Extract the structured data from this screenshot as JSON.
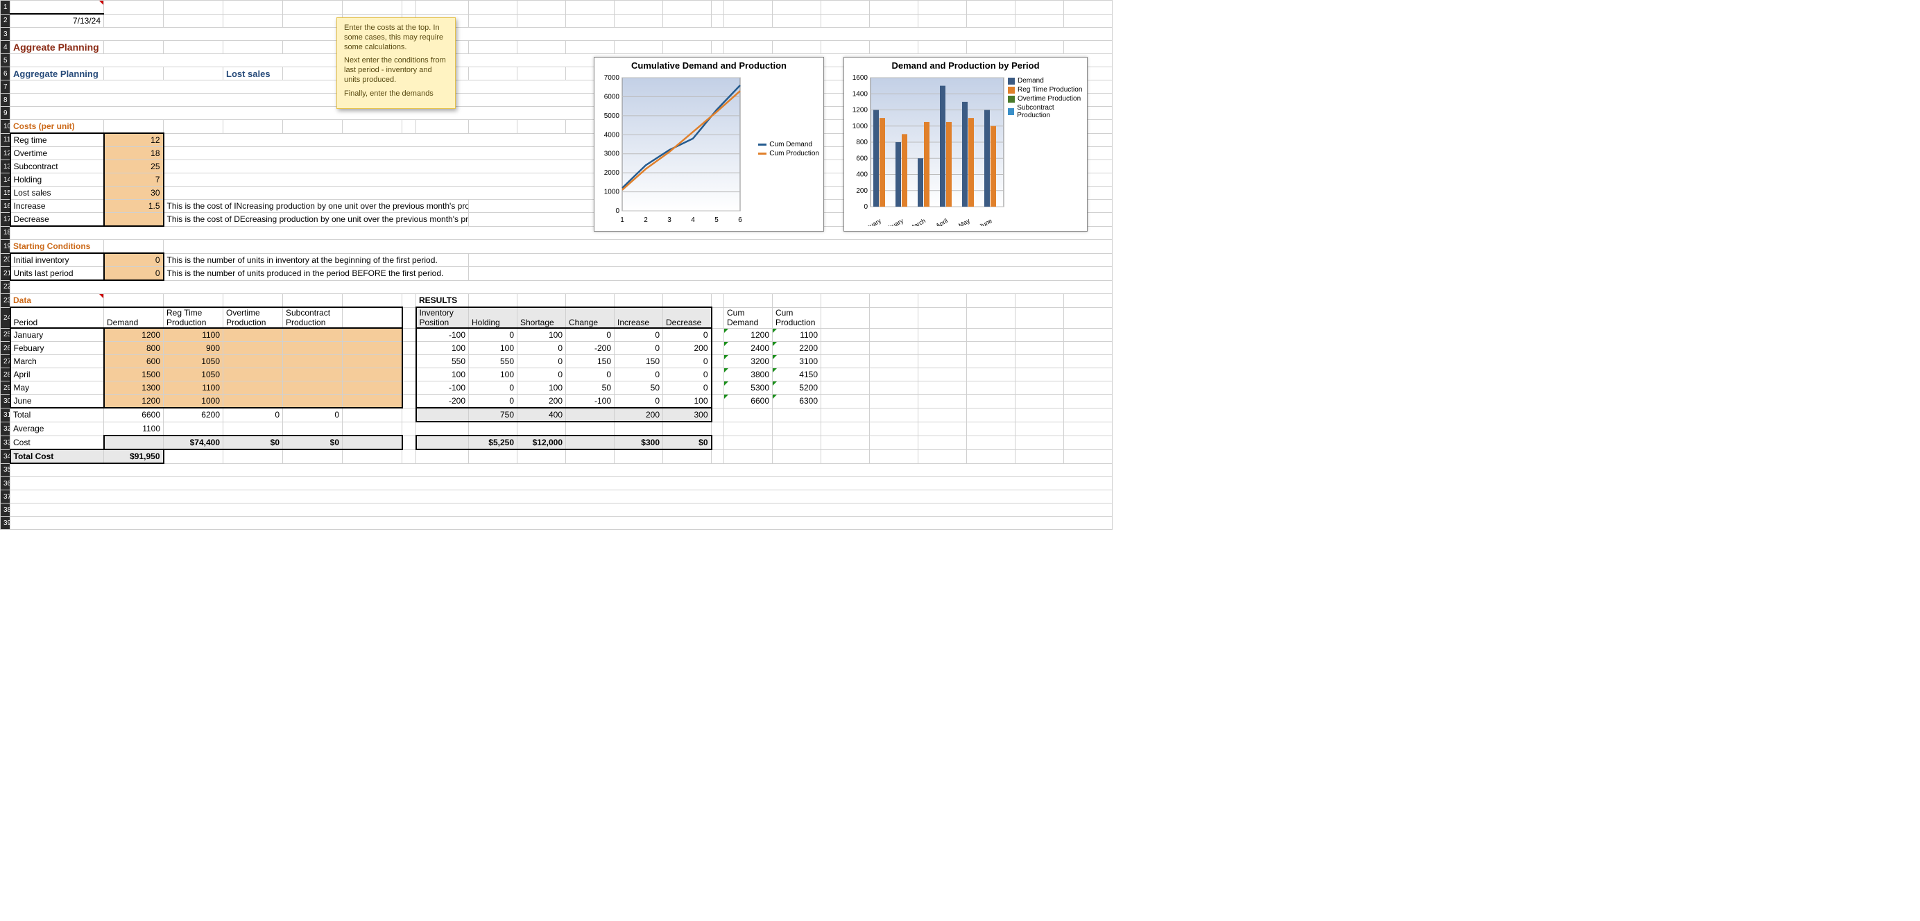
{
  "date": "7/13/24",
  "titles": {
    "aggreate": "Aggreate Planning",
    "aggregate": "Aggregate Planning",
    "lost_sales": "Lost sales"
  },
  "note": {
    "p1": "Enter the costs at the top. In some cases, this may require some calculations.",
    "p2": "Next enter the conditions from last period - inventory and units produced.",
    "p3": "Finally, enter the demands"
  },
  "sections": {
    "costs": "Costs (per unit)",
    "starting": "Starting Conditions",
    "data": "Data",
    "results": "RESULTS"
  },
  "costs": {
    "rows": [
      {
        "label": "Reg time",
        "value": "12"
      },
      {
        "label": "Overtime",
        "value": "18"
      },
      {
        "label": "Subcontract",
        "value": "25"
      },
      {
        "label": "Holding",
        "value": "7"
      },
      {
        "label": "Lost sales",
        "value": "30"
      },
      {
        "label": "Increase",
        "value": "1.5",
        "note": "This is the cost of INcreasing production by one unit over the previous month's production quantity."
      },
      {
        "label": "Decrease",
        "value": "",
        "note": "This is the cost of DEcreasing production by one unit over the previous month's production quantity."
      }
    ],
    "unit_word": "unit"
  },
  "starting": {
    "rows": [
      {
        "label": "Initial inventory",
        "value": "0",
        "note": "This is the number of units in inventory at the beginning of the first period."
      },
      {
        "label": "Units last period",
        "value": "0",
        "note": "This is the number of units produced in the period BEFORE the first period."
      }
    ]
  },
  "data": {
    "headers": {
      "period": "Period",
      "demand": "Demand",
      "reg": "Reg Time Production",
      "ot": "Overtime Production",
      "sub": "Subcontract Production"
    },
    "rows": [
      {
        "period": "January",
        "demand": "1200",
        "reg": "1100",
        "ot": "",
        "sub": ""
      },
      {
        "period": "Febuary",
        "demand": "800",
        "reg": "900",
        "ot": "",
        "sub": ""
      },
      {
        "period": "March",
        "demand": "600",
        "reg": "1050",
        "ot": "",
        "sub": ""
      },
      {
        "period": "April",
        "demand": "1500",
        "reg": "1050",
        "ot": "",
        "sub": ""
      },
      {
        "period": "May",
        "demand": "1300",
        "reg": "1100",
        "ot": "",
        "sub": ""
      },
      {
        "period": "June",
        "demand": "1200",
        "reg": "1000",
        "ot": "",
        "sub": ""
      }
    ],
    "totals": {
      "label": "Total",
      "demand": "6600",
      "reg": "6200",
      "ot": "0",
      "sub": "0"
    },
    "average": {
      "label": "Average",
      "demand": "1100"
    },
    "cost_row": {
      "label": "Cost",
      "reg": "$74,400",
      "ot": "$0",
      "sub": "$0"
    },
    "total_cost": {
      "label": "Total Cost",
      "value": "$91,950"
    }
  },
  "results": {
    "headers": {
      "inv": "Inventory Position",
      "hold": "Holding",
      "short": "Shortage",
      "change": "Change",
      "inc": "Increase",
      "dec": "Decrease"
    },
    "rows": [
      {
        "inv": "-100",
        "hold": "0",
        "short": "100",
        "change": "0",
        "inc": "0",
        "dec": "0"
      },
      {
        "inv": "100",
        "hold": "100",
        "short": "0",
        "change": "-200",
        "inc": "0",
        "dec": "200"
      },
      {
        "inv": "550",
        "hold": "550",
        "short": "0",
        "change": "150",
        "inc": "150",
        "dec": "0"
      },
      {
        "inv": "100",
        "hold": "100",
        "short": "0",
        "change": "0",
        "inc": "0",
        "dec": "0"
      },
      {
        "inv": "-100",
        "hold": "0",
        "short": "100",
        "change": "50",
        "inc": "50",
        "dec": "0"
      },
      {
        "inv": "-200",
        "hold": "0",
        "short": "200",
        "change": "-100",
        "inc": "0",
        "dec": "100"
      }
    ],
    "totals": {
      "hold": "750",
      "short": "400",
      "inc": "200",
      "dec": "300"
    },
    "cost_row": {
      "hold": "$5,250",
      "short": "$12,000",
      "inc": "$300",
      "dec": "$0"
    }
  },
  "cum": {
    "headers": {
      "demand": "Cum Demand",
      "prod": "Cum Production"
    },
    "rows": [
      {
        "d": "1200",
        "p": "1100"
      },
      {
        "d": "2400",
        "p": "2200"
      },
      {
        "d": "3200",
        "p": "3100"
      },
      {
        "d": "3800",
        "p": "4150"
      },
      {
        "d": "5300",
        "p": "5200"
      },
      {
        "d": "6600",
        "p": "6300"
      }
    ]
  },
  "chart_data": [
    {
      "type": "line",
      "title": "Cumulative Demand and Production",
      "x": [
        1,
        2,
        3,
        4,
        5,
        6
      ],
      "ylim": [
        0,
        7000
      ],
      "yticks": [
        0,
        1000,
        2000,
        3000,
        4000,
        5000,
        6000,
        7000
      ],
      "series": [
        {
          "name": "Cum Demand",
          "color": "#245b8f",
          "values": [
            1200,
            2400,
            3200,
            3800,
            5300,
            6600
          ]
        },
        {
          "name": "Cum Production",
          "color": "#e0802b",
          "values": [
            1100,
            2200,
            3100,
            4150,
            5200,
            6300
          ]
        }
      ]
    },
    {
      "type": "bar",
      "title": "Demand and Production by Period",
      "categories": [
        "January",
        "Febuary",
        "March",
        "April",
        "May",
        "June"
      ],
      "ylim": [
        0,
        1600
      ],
      "yticks": [
        0,
        200,
        400,
        600,
        800,
        1000,
        1200,
        1400,
        1600
      ],
      "series": [
        {
          "name": "Demand",
          "color": "#3c5b83",
          "values": [
            1200,
            800,
            600,
            1500,
            1300,
            1200
          ]
        },
        {
          "name": "Reg Time Production",
          "color": "#e0802b",
          "values": [
            1100,
            900,
            1050,
            1050,
            1100,
            1000
          ]
        },
        {
          "name": "Overtime Production",
          "color": "#4a7a2b",
          "values": [
            0,
            0,
            0,
            0,
            0,
            0
          ]
        },
        {
          "name": "Subcontract Production",
          "color": "#3a8fc8",
          "values": [
            0,
            0,
            0,
            0,
            0,
            0
          ]
        }
      ]
    }
  ]
}
